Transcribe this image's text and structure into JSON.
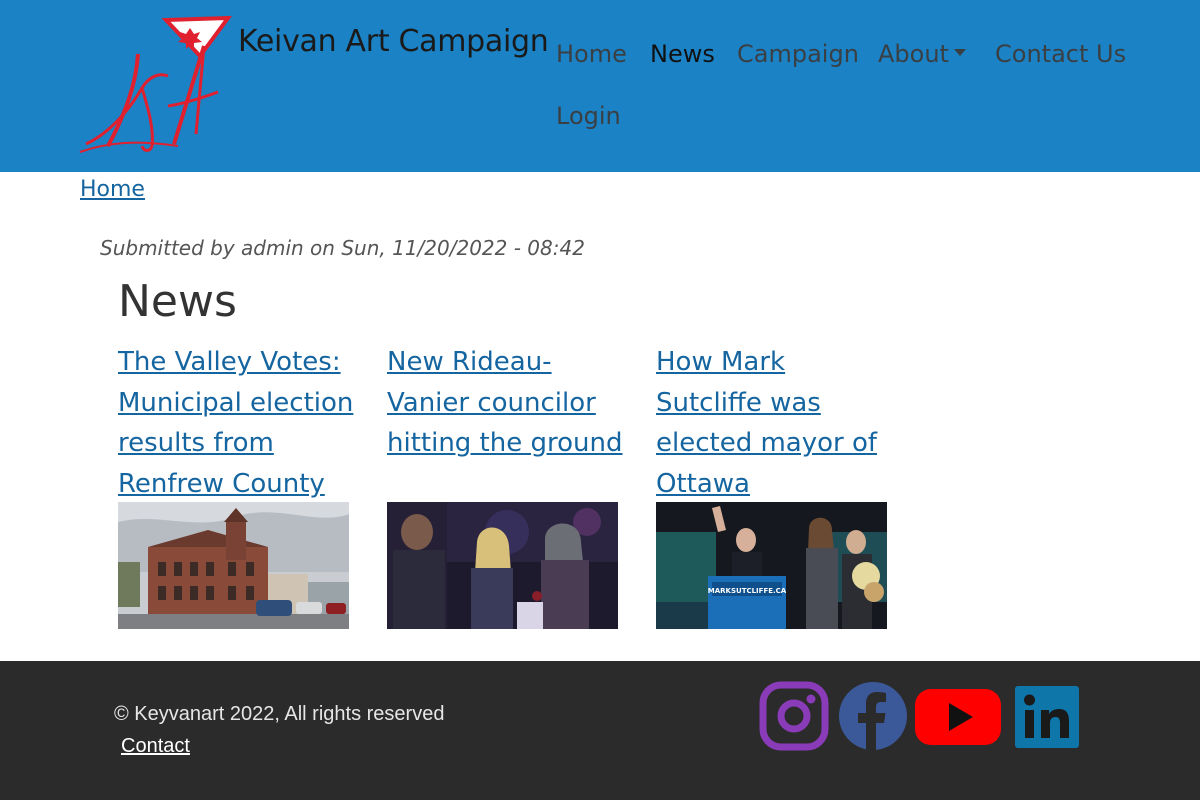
{
  "site": {
    "name": "Keivan Art Campaign",
    "logo_text": "KA"
  },
  "nav": {
    "items": [
      {
        "label": "Home"
      },
      {
        "label": "News"
      },
      {
        "label": "Campaign"
      },
      {
        "label": "About"
      },
      {
        "label": "Contact Us"
      },
      {
        "label": "Login"
      }
    ],
    "active": "News"
  },
  "breadcrumb": {
    "home": "Home"
  },
  "article": {
    "submitted": "Submitted by admin on Sun, 11/20/2022 - 08:42",
    "title": "News"
  },
  "news_cards": [
    {
      "title": "The Valley Votes: Municipal election results from Renfrew County",
      "image": "town-hall-photo"
    },
    {
      "title": "New Rideau-Vanier councilor hitting the ground",
      "image": "event-crowd-photo"
    },
    {
      "title": "How Mark Sutcliffe was elected mayor of Ottawa",
      "image": "victory-speech-photo",
      "podium_text": "MARKSUTCLIFFE.CA"
    }
  ],
  "footer": {
    "copyright": "© Keyvanart 2022, All rights reserved",
    "contact": "Contact",
    "social": [
      "instagram-icon",
      "facebook-icon",
      "youtube-icon",
      "linkedin-icon"
    ]
  },
  "colors": {
    "header_bg": "#1b82c5",
    "link": "#1565a0",
    "footer_bg": "#2b2b2b",
    "logo_red": "#e0202e"
  }
}
